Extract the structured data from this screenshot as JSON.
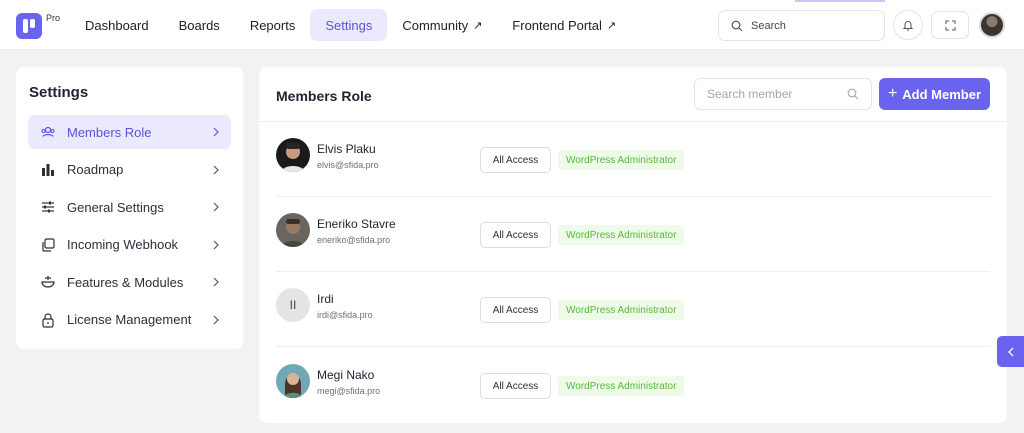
{
  "app": {
    "logo_sup": "Pro"
  },
  "nav": {
    "items": [
      {
        "label": "Dashboard",
        "external": false,
        "active": false
      },
      {
        "label": "Boards",
        "external": false,
        "active": false
      },
      {
        "label": "Reports",
        "external": false,
        "active": false
      },
      {
        "label": "Settings",
        "external": false,
        "active": true
      },
      {
        "label": "Community",
        "external": true,
        "active": false
      },
      {
        "label": "Frontend Portal",
        "external": true,
        "active": false
      }
    ],
    "external_glyph": "↗",
    "search_placeholder": "Search"
  },
  "sidebar": {
    "title": "Settings",
    "items": [
      {
        "label": "Members Role",
        "icon": "users-icon",
        "active": true
      },
      {
        "label": "Roadmap",
        "icon": "bar-chart-icon",
        "active": false
      },
      {
        "label": "General Settings",
        "icon": "sliders-icon",
        "active": false
      },
      {
        "label": "Incoming Webhook",
        "icon": "copy-icon",
        "active": false
      },
      {
        "label": "Features & Modules",
        "icon": "bowl-icon",
        "active": false
      },
      {
        "label": "License Management",
        "icon": "lock-icon",
        "active": false
      }
    ]
  },
  "main": {
    "title": "Members Role",
    "search_placeholder": "Search member",
    "add_label": "Add Member",
    "members": [
      {
        "name": "Elvis Plaku",
        "email": "elvis@sfida.pro",
        "access": "All Access",
        "role": "WordPress Administrator",
        "avatar": "photo",
        "initials": ""
      },
      {
        "name": "Eneriko Stavre",
        "email": "eneriko@sfida.pro",
        "access": "All Access",
        "role": "WordPress Administrator",
        "avatar": "photo",
        "initials": ""
      },
      {
        "name": "Irdi",
        "email": "irdi@sfida.pro",
        "access": "All Access",
        "role": "WordPress Administrator",
        "avatar": "initials",
        "initials": "II"
      },
      {
        "name": "Megi Nako",
        "email": "megi@sfida.pro",
        "access": "All Access",
        "role": "WordPress Administrator",
        "avatar": "photo",
        "initials": ""
      }
    ]
  },
  "colors": {
    "accent": "#6a63ef",
    "accent_soft": "#ebe9fd",
    "badge_bg": "#eefbe8",
    "badge_text": "#57b83a"
  }
}
